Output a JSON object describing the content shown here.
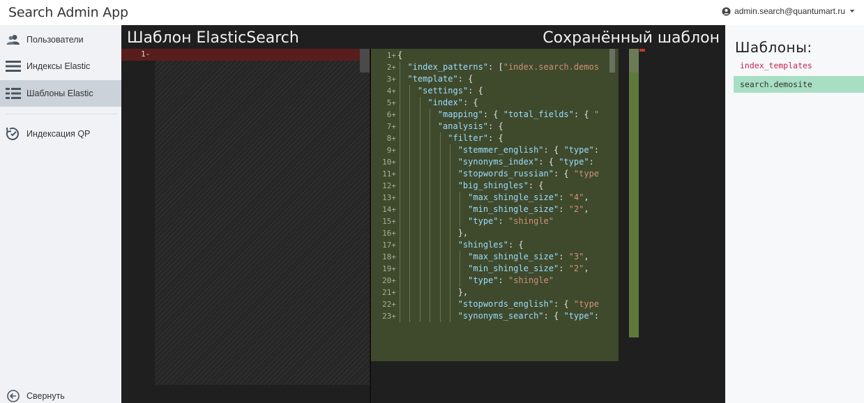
{
  "header": {
    "app_title": "Search Admin App",
    "user_email": "admin.search@quantumart.ru",
    "user_icon": "user-circle-icon",
    "dropdown_icon": "caret-down-icon"
  },
  "sidebar": {
    "items": [
      {
        "label": "Пользователи",
        "icon": "users-icon"
      },
      {
        "label": "Индексы Elastic",
        "icon": "list-icon"
      },
      {
        "label": "Шаблоны Elastic",
        "icon": "grid-list-icon",
        "active": true
      },
      {
        "label": "Индексация QP",
        "icon": "sync-clock-icon"
      }
    ],
    "collapse_label": "Свернуть",
    "collapse_icon": "arrow-left-circle-icon"
  },
  "editor": {
    "left_title": "Шаблон ElasticSearch",
    "right_title": "Сохранённый шаблон",
    "left_lines": [
      {
        "num": "1-"
      }
    ],
    "right_lines": [
      {
        "num": "1+",
        "text": "{"
      },
      {
        "num": "2+",
        "text": "  \"index_patterns\": [\"index.search.demos"
      },
      {
        "num": "3+",
        "text": "  \"template\": {"
      },
      {
        "num": "4+",
        "text": "    \"settings\": {"
      },
      {
        "num": "5+",
        "text": "      \"index\": {"
      },
      {
        "num": "6+",
        "text": "        \"mapping\": { \"total_fields\": { \""
      },
      {
        "num": "7+",
        "text": "        \"analysis\": {"
      },
      {
        "num": "8+",
        "text": "          \"filter\": {"
      },
      {
        "num": "9+",
        "text": "            \"stemmer_english\": { \"type\":"
      },
      {
        "num": "10+",
        "text": "            \"synonyms_index\": { \"type\":"
      },
      {
        "num": "11+",
        "text": "            \"stopwords_russian\": { \"type"
      },
      {
        "num": "12+",
        "text": "            \"big_shingles\": {"
      },
      {
        "num": "13+",
        "text": "              \"max_shingle_size\": \"4\","
      },
      {
        "num": "14+",
        "text": "              \"min_shingle_size\": \"2\","
      },
      {
        "num": "15+",
        "text": "              \"type\": \"shingle\""
      },
      {
        "num": "16+",
        "text": "            },"
      },
      {
        "num": "17+",
        "text": "            \"shingles\": {"
      },
      {
        "num": "18+",
        "text": "              \"max_shingle_size\": \"3\","
      },
      {
        "num": "19+",
        "text": "              \"min_shingle_size\": \"2\","
      },
      {
        "num": "20+",
        "text": "              \"type\": \"shingle\""
      },
      {
        "num": "21+",
        "text": "            },"
      },
      {
        "num": "22+",
        "text": "            \"stopwords_english\": { \"type"
      },
      {
        "num": "23+",
        "text": "            \"synonyms_search\": { \"type\":"
      }
    ]
  },
  "templates": {
    "title": "Шаблоны:",
    "items": [
      {
        "label": "index_templates",
        "style": "red"
      },
      {
        "label": "search.demosite",
        "style": "selected"
      }
    ]
  },
  "colors": {
    "added_bg": "#3f4a2c",
    "removed_bg": "#5a1d1d",
    "selected_template": "#a8dfc4",
    "key": "#9cdcfe",
    "string": "#ce9178"
  }
}
